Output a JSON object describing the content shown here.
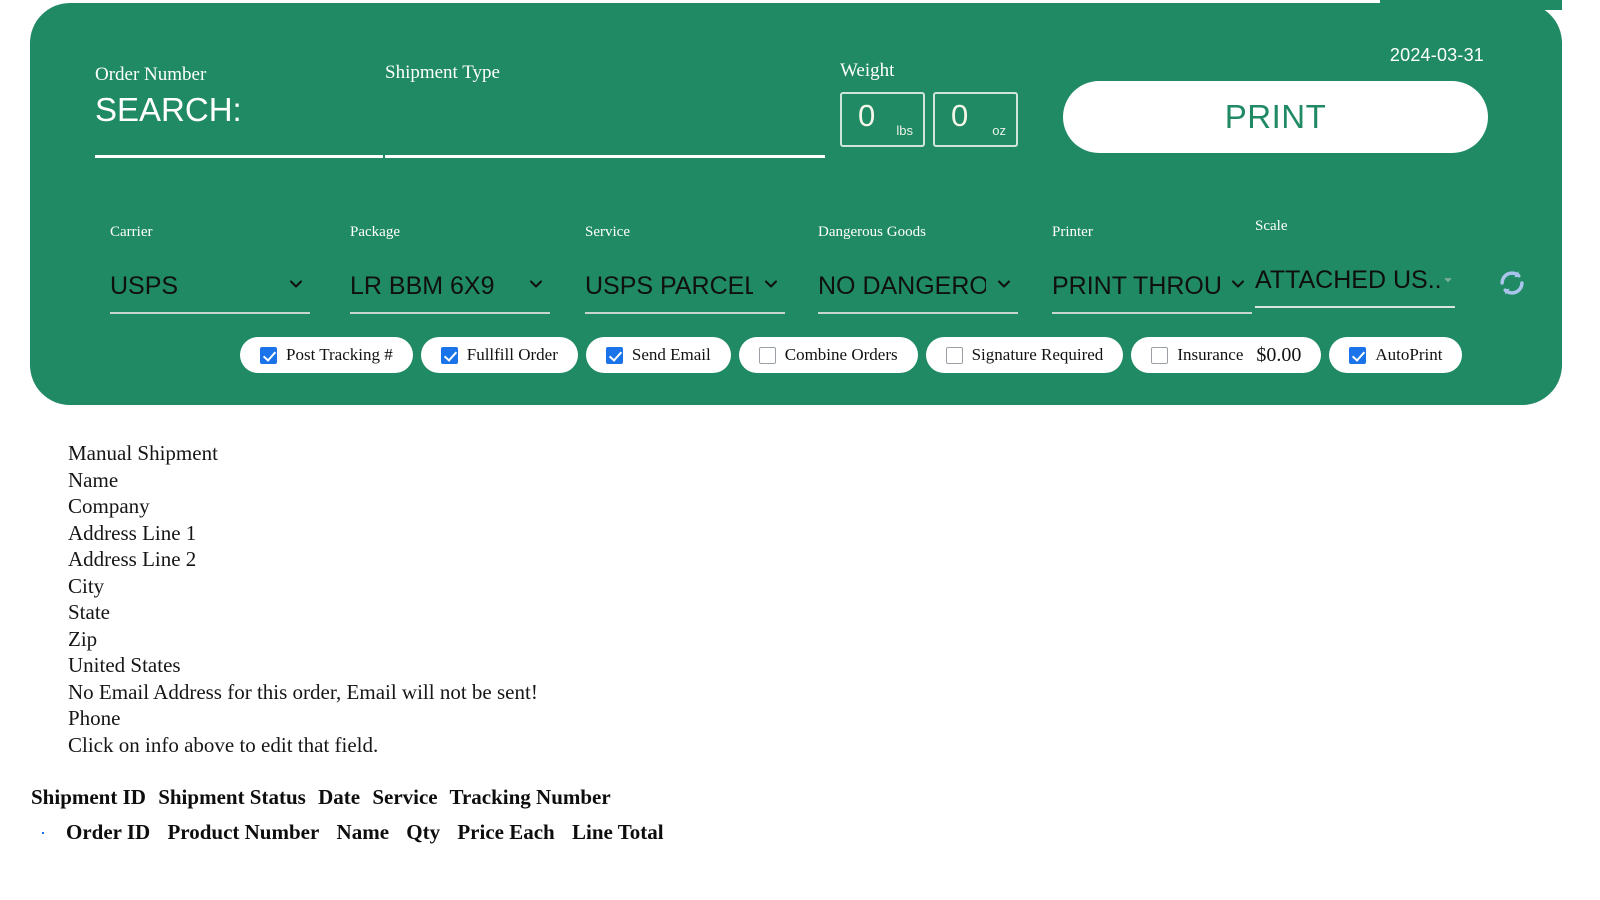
{
  "theme": {
    "card_green": "#1f8a63",
    "checkbox_blue": "#1a73e8",
    "refresh_icon_blue": "#aac4ec"
  },
  "header_card": {
    "date": "2024-03-31",
    "order_number": {
      "label": "Order Number",
      "value": "SEARCH:"
    },
    "shipment_type": {
      "label": "Shipment Type",
      "value": ""
    },
    "weight": {
      "label": "Weight",
      "lbs_value": "0",
      "lbs_unit": "lbs",
      "oz_value": "0",
      "oz_unit": "oz"
    },
    "print_button_label": "PRINT"
  },
  "dropdowns": [
    {
      "label": "Carrier",
      "value": "USPS"
    },
    {
      "label": "Package",
      "value": "LR BBM 6X9"
    },
    {
      "label": "Service",
      "value": "USPS PARCEL S"
    },
    {
      "label": "Dangerous Goods",
      "value": "NO DANGEROUS"
    },
    {
      "label": "Printer",
      "value": "PRINT THROUGH"
    },
    {
      "label": "Scale",
      "value": "ATTACHED US..."
    }
  ],
  "options": [
    {
      "label": "Post Tracking #",
      "checked": true
    },
    {
      "label": "Fullfill Order",
      "checked": true
    },
    {
      "label": "Send Email",
      "checked": true
    },
    {
      "label": "Combine Orders",
      "checked": false
    },
    {
      "label": "Signature Required",
      "checked": false
    },
    {
      "label": "Insurance",
      "amount": "$0.00",
      "checked": false
    },
    {
      "label": "AutoPrint",
      "checked": true
    }
  ],
  "address_block": [
    "Manual Shipment",
    "Name",
    "Company",
    "Address Line 1",
    "Address Line 2",
    "City",
    "State",
    "Zip",
    "United States",
    "No Email Address for this order, Email will not be sent!",
    "Phone",
    "Click on info above to edit that field."
  ],
  "shipment_table": {
    "columns": [
      "Shipment ID",
      "Shipment Status",
      "Date",
      "Service",
      "Tracking Number"
    ]
  },
  "lineitem_table": {
    "select_all_checked": true,
    "columns": [
      "Order ID",
      "Product Number",
      "Name",
      "Qty",
      "Price Each",
      "Line Total"
    ]
  }
}
